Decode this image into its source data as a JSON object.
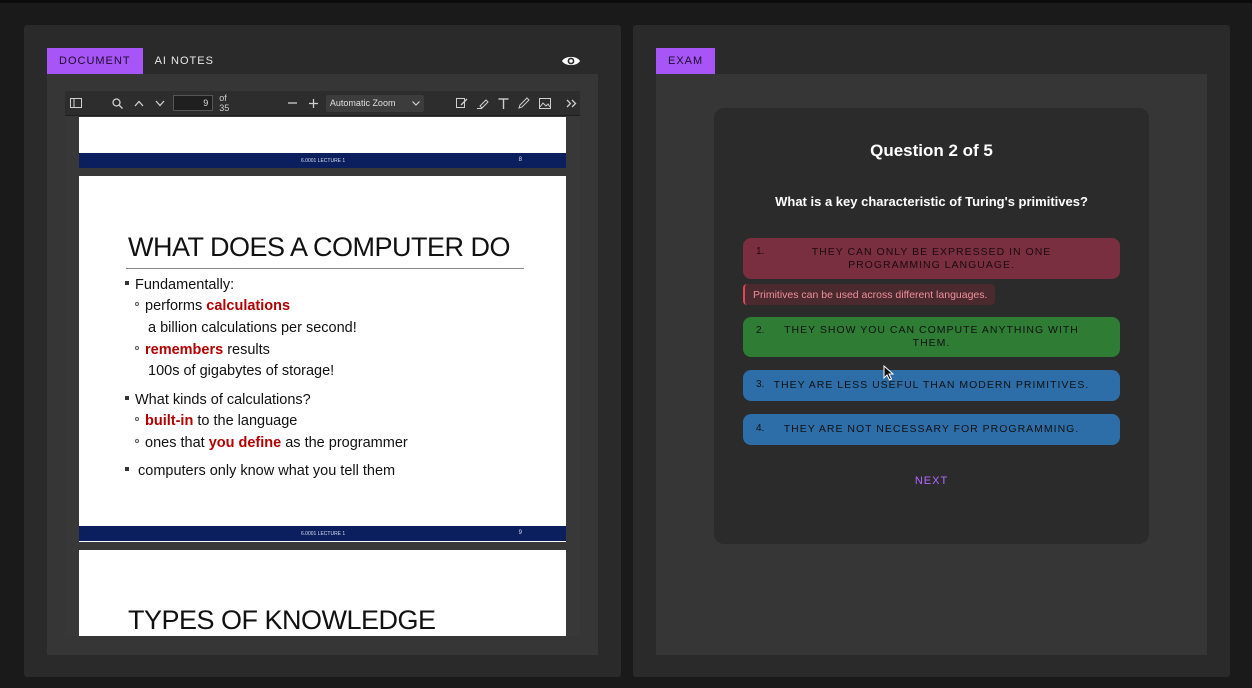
{
  "left_tabs": {
    "document": "DOCUMENT",
    "ai_notes": "AI NOTES"
  },
  "right_tabs": {
    "exam": "EXAM"
  },
  "pdf_toolbar": {
    "page_number": "9",
    "page_total": "of 35",
    "zoom": "Automatic Zoom"
  },
  "pdf_pages": {
    "footer_label": "6.0001 LECTURE 1",
    "prev_page_num": "8",
    "current_page_num": "9",
    "slide_title": "WHAT DOES A COMPUTER DO",
    "bullet1": "Fundamentally:",
    "sub1_a": "performs ",
    "sub1_b": "calculations",
    "sub1_line2": "a billion calculations per second!",
    "sub2_a": "remembers",
    "sub2_b": " results",
    "sub2_line2": "100s of gigabytes of storage!",
    "bullet2": "What kinds of calculations?",
    "sub3_a": "built-in",
    "sub3_b": " to the language",
    "sub4_a": "ones that ",
    "sub4_b": "you define",
    "sub4_c": " as the programmer",
    "bullet3": "computers only know what you tell them",
    "next_slide_title": "TYPES OF KNOWLEDGE"
  },
  "exam": {
    "heading": "Question 2 of 5",
    "question": "What is a key characteristic of Turing's primitives?",
    "options": [
      {
        "num": "1.",
        "text": "THEY CAN ONLY BE EXPRESSED IN ONE PROGRAMMING LANGUAGE."
      },
      {
        "num": "2.",
        "text": "THEY SHOW YOU CAN COMPUTE ANYTHING WITH THEM."
      },
      {
        "num": "3.",
        "text": "THEY ARE LESS USEFUL THAN MODERN PRIMITIVES."
      },
      {
        "num": "4.",
        "text": "THEY ARE NOT NECESSARY FOR PROGRAMMING."
      }
    ],
    "feedback": "Primitives can be used across different languages.",
    "next_label": "NEXT"
  },
  "colors": {
    "accent": "#a855f7",
    "wrong": "#7a2f40",
    "correct": "#2f7d35",
    "neutral": "#2d6ea8",
    "slide_footer": "#0b1f5e"
  },
  "icons": [
    "sidebar-toggle-icon",
    "search-icon",
    "chevron-up-icon",
    "chevron-down-icon",
    "minus-icon",
    "plus-icon",
    "edit-icon",
    "highlight-icon",
    "text-icon",
    "draw-icon",
    "image-icon",
    "more-tools-icon",
    "eye-icon"
  ]
}
